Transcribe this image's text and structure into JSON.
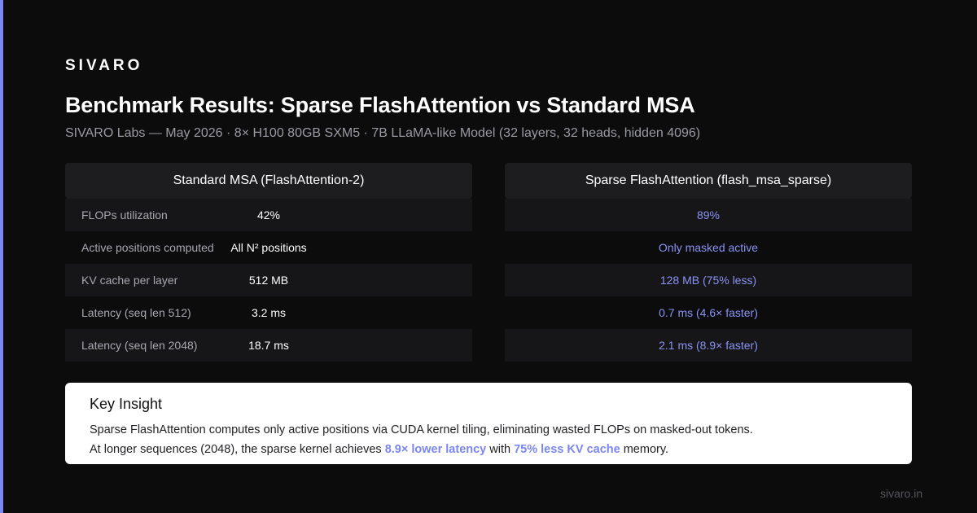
{
  "brand": "SIVARO",
  "title": "Benchmark Results: Sparse FlashAttention vs Standard MSA",
  "subtitle": "SIVARO Labs — May 2026 · 8× H100 80GB SXM5 · 7B LLaMA-like Model (32 layers, 32 heads, hidden 4096)",
  "left_table": {
    "header": "Standard MSA (FlashAttention-2)",
    "rows": [
      {
        "label": "FLOPs utilization",
        "value": "42%"
      },
      {
        "label": "Active positions computed",
        "value": "All N² positions"
      },
      {
        "label": "KV cache per layer",
        "value": "512 MB"
      },
      {
        "label": "Latency (seq len 512)",
        "value": "3.2 ms"
      },
      {
        "label": "Latency (seq len 2048)",
        "value": "18.7 ms"
      }
    ]
  },
  "right_table": {
    "header": "Sparse FlashAttention (flash_msa_sparse)",
    "rows": [
      {
        "value": "89%"
      },
      {
        "value": "Only masked active"
      },
      {
        "value": "128 MB (75% less)"
      },
      {
        "value": "0.7 ms (4.6× faster)"
      },
      {
        "value": "2.1 ms (8.9× faster)"
      }
    ]
  },
  "insight": {
    "title": "Key Insight",
    "line1": "Sparse FlashAttention computes only active positions via CUDA kernel tiling, eliminating wasted FLOPs on masked-out tokens.",
    "line2_pre": "At longer sequences (2048), the sparse kernel achieves ",
    "line2_hl1": "8.9× lower latency",
    "line2_mid": " with ",
    "line2_hl2": "75% less KV cache",
    "line2_post": " memory."
  },
  "footer": "sivaro.in",
  "colors": {
    "background": "#0c0c0d",
    "accent": "#7b86f0",
    "table_header": "#1d1d20",
    "row_alt": "#161618"
  }
}
